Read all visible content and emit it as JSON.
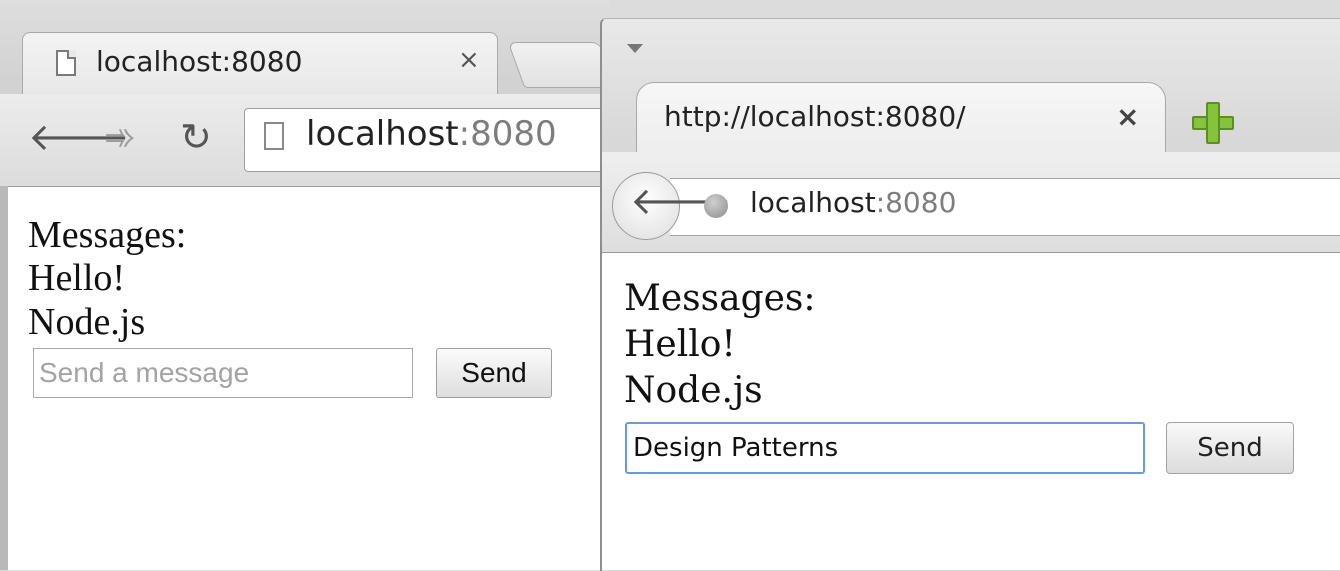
{
  "left_window": {
    "tab_title": "localhost:8080",
    "tab_close": "×",
    "address": {
      "host": "localhost",
      "port": ":8080"
    },
    "nav": {
      "back": "🡐",
      "forward": "➾",
      "reload": "↻"
    },
    "messages_heading": "Messages:",
    "messages": [
      "Hello!",
      "Node.js"
    ],
    "input": {
      "value": "",
      "placeholder": "Send a message"
    },
    "send_label": "Send"
  },
  "right_window": {
    "tab_title": "http://localhost:8080/",
    "tab_close": "×",
    "address": {
      "host": "localhost",
      "port": ":8080"
    },
    "nav": {
      "back": "🡐"
    },
    "messages_heading": "Messages:",
    "messages": [
      "Hello!",
      "Node.js"
    ],
    "input": {
      "value": "Design Patterns",
      "placeholder": ""
    },
    "send_label": "Send",
    "colors": {
      "new_tab_plus": "#86c33c",
      "focus_border": "#6d9ad6"
    }
  }
}
